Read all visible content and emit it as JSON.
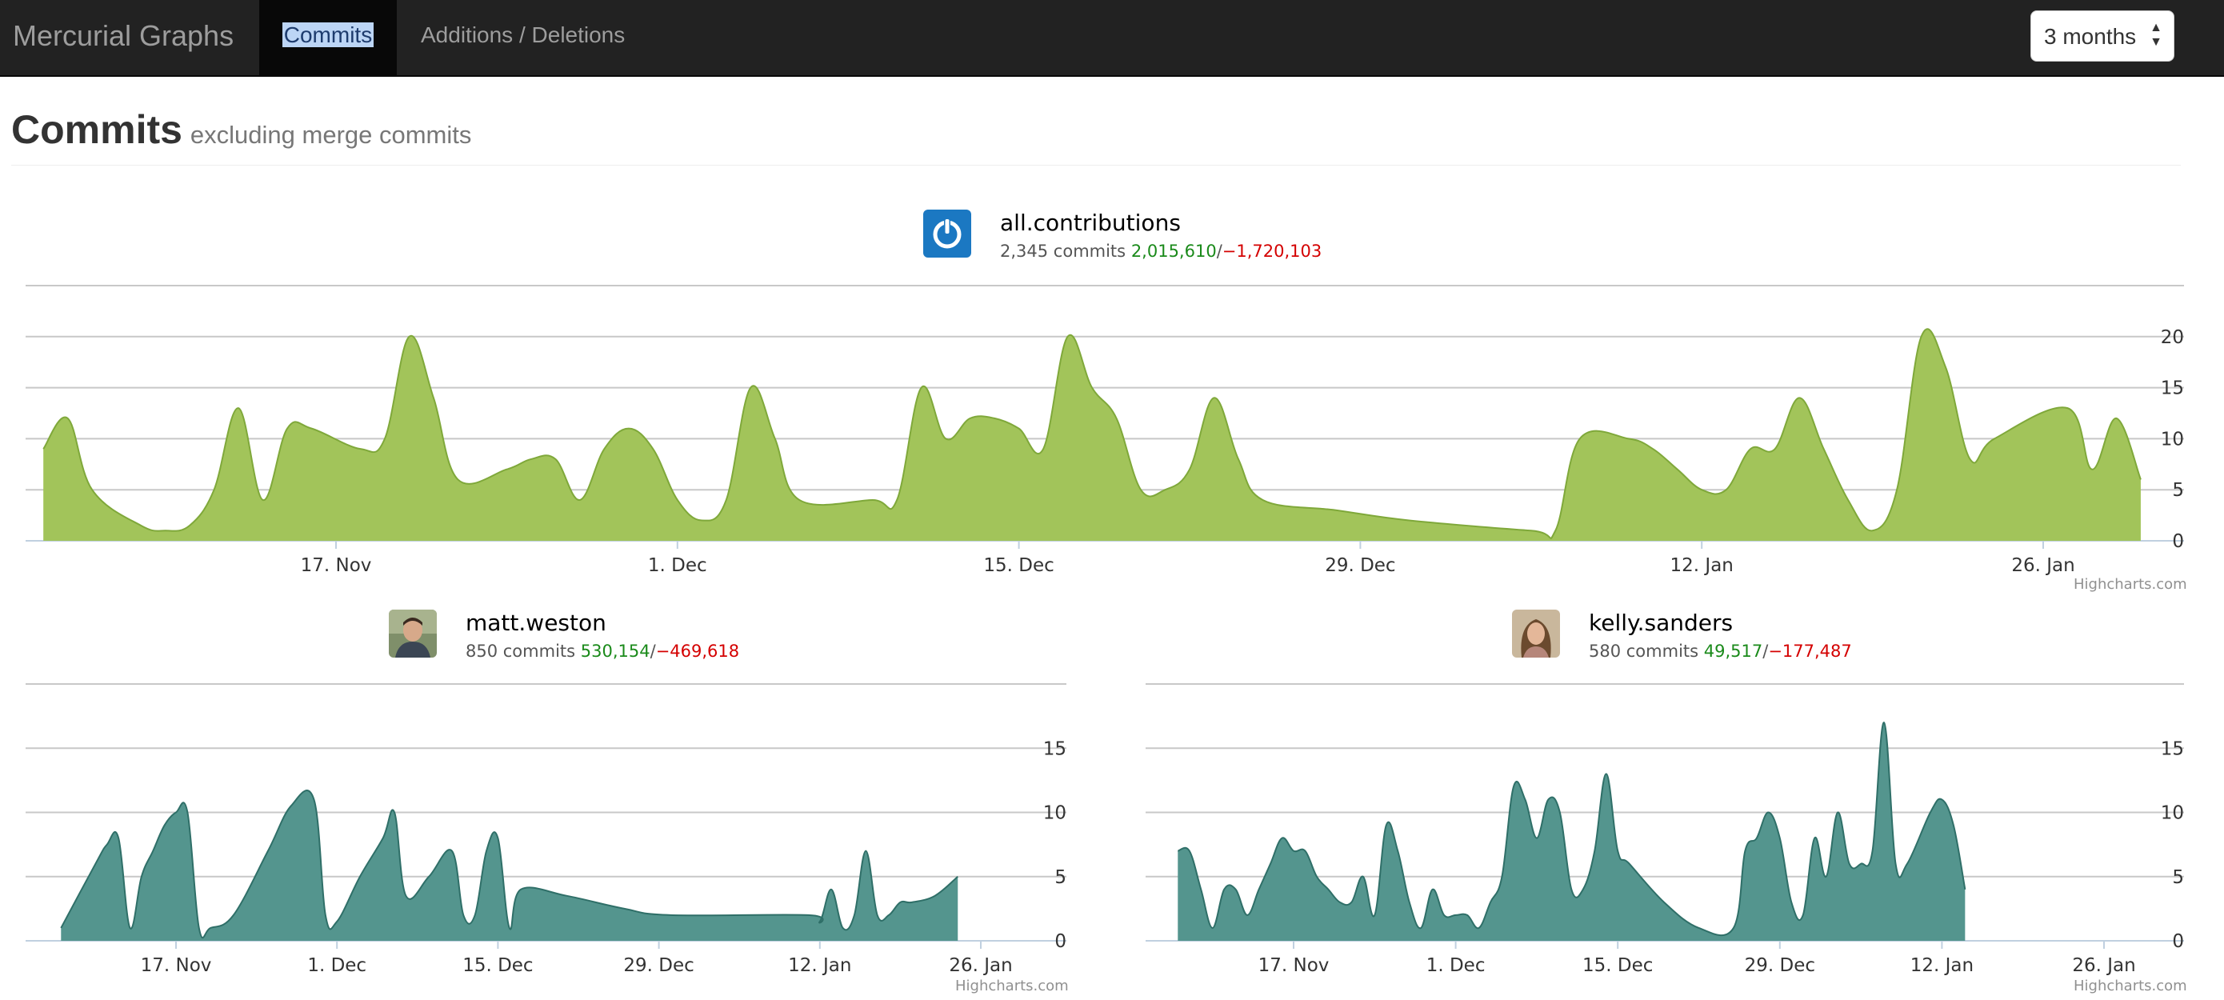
{
  "nav": {
    "brand": "Mercurial Graphs",
    "tabs": [
      {
        "label": "Commits",
        "active": true
      },
      {
        "label": "Additions / Deletions",
        "active": false
      }
    ],
    "range_select": {
      "value": "3 months"
    }
  },
  "header": {
    "title": "Commits",
    "subtitle": "excluding merge commits"
  },
  "colors": {
    "all_fill": "#a2c45a",
    "all_line": "#7fa83a",
    "user_fill": "#54958e",
    "user_line": "#2f6f68",
    "additions": "#1a8a1a",
    "deletions": "#d40000"
  },
  "credit": "Highcharts.com",
  "people": [
    {
      "name": "all.contributions",
      "commits_text": "2,345 commits",
      "additions": "2,015,610",
      "separator": "/",
      "deletions": "−1,720,103",
      "icon": "power-icon"
    },
    {
      "name": "matt.weston",
      "commits_text": "850 commits",
      "additions": "530,154",
      "separator": "/",
      "deletions": "−469,618",
      "icon": "avatar-photo"
    },
    {
      "name": "kelly.sanders",
      "commits_text": "580 commits",
      "additions": "49,517",
      "separator": "/",
      "deletions": "−177,487",
      "icon": "avatar-photo"
    }
  ],
  "chart_data": [
    {
      "type": "area",
      "title": "all.contributions",
      "x_ticks": [
        {
          "day": 19,
          "label": "17. Nov"
        },
        {
          "day": 33,
          "label": "1. Dec"
        },
        {
          "day": 47,
          "label": "15. Dec"
        },
        {
          "day": 61,
          "label": "29. Dec"
        },
        {
          "day": 75,
          "label": "12. Jan"
        },
        {
          "day": 89,
          "label": "26. Jan"
        }
      ],
      "y_ticks": [
        0,
        5,
        10,
        15,
        20
      ],
      "ylim": [
        0,
        25
      ],
      "xlim": [
        6,
        92
      ],
      "points": [
        [
          7,
          9
        ],
        [
          8,
          12
        ],
        [
          9,
          5
        ],
        [
          11,
          1.5
        ],
        [
          12,
          1
        ],
        [
          13,
          1.5
        ],
        [
          14,
          5
        ],
        [
          15,
          13
        ],
        [
          16,
          4
        ],
        [
          17,
          11
        ],
        [
          18,
          11
        ],
        [
          20,
          9
        ],
        [
          21,
          10
        ],
        [
          22,
          20
        ],
        [
          23,
          14
        ],
        [
          24,
          6
        ],
        [
          26,
          7
        ],
        [
          27,
          8
        ],
        [
          28,
          8
        ],
        [
          29,
          4
        ],
        [
          30,
          9
        ],
        [
          31,
          11
        ],
        [
          32,
          9
        ],
        [
          33,
          4
        ],
        [
          34,
          2
        ],
        [
          35,
          4
        ],
        [
          36,
          15
        ],
        [
          37,
          10
        ],
        [
          38,
          4
        ],
        [
          41,
          4
        ],
        [
          42,
          4
        ],
        [
          43,
          15
        ],
        [
          44,
          10
        ],
        [
          45,
          12
        ],
        [
          46,
          12
        ],
        [
          47,
          11
        ],
        [
          48,
          9
        ],
        [
          49,
          20
        ],
        [
          50,
          15
        ],
        [
          51,
          12
        ],
        [
          52,
          5
        ],
        [
          53,
          5
        ],
        [
          54,
          7
        ],
        [
          55,
          14
        ],
        [
          56,
          8
        ],
        [
          57,
          4
        ],
        [
          60,
          3
        ],
        [
          63,
          2
        ],
        [
          68,
          1
        ],
        [
          69,
          1
        ],
        [
          70,
          10
        ],
        [
          72,
          10
        ],
        [
          73,
          9
        ],
        [
          74,
          7
        ],
        [
          75,
          5
        ],
        [
          76,
          5
        ],
        [
          77,
          9
        ],
        [
          78,
          9
        ],
        [
          79,
          14
        ],
        [
          80,
          9
        ],
        [
          81,
          4
        ],
        [
          82,
          1
        ],
        [
          83,
          5
        ],
        [
          84,
          20
        ],
        [
          85,
          17
        ],
        [
          86,
          8
        ],
        [
          87,
          10
        ],
        [
          90,
          13
        ],
        [
          91,
          7
        ],
        [
          92,
          12
        ],
        [
          93,
          6
        ]
      ],
      "credit_shown": true
    },
    {
      "type": "area",
      "title": "matt.weston",
      "x_ticks": [
        {
          "day": 19,
          "label": "17. Nov"
        },
        {
          "day": 33,
          "label": "1. Dec"
        },
        {
          "day": 47,
          "label": "15. Dec"
        },
        {
          "day": 61,
          "label": "29. Dec"
        },
        {
          "day": 75,
          "label": "12. Jan"
        },
        {
          "day": 89,
          "label": "26. Jan"
        }
      ],
      "y_ticks": [
        0,
        5,
        10,
        15
      ],
      "ylim": [
        0,
        20
      ],
      "xlim": [
        8,
        92
      ],
      "points": [
        [
          9,
          1
        ],
        [
          12,
          6
        ],
        [
          13,
          7.5
        ],
        [
          14,
          8
        ],
        [
          15,
          1
        ],
        [
          16,
          5
        ],
        [
          17,
          7
        ],
        [
          18,
          9
        ],
        [
          19,
          10
        ],
        [
          20,
          10
        ],
        [
          21,
          1
        ],
        [
          22,
          1
        ],
        [
          24,
          2
        ],
        [
          27,
          7
        ],
        [
          29,
          10.5
        ],
        [
          31,
          11
        ],
        [
          32,
          2
        ],
        [
          33,
          1.5
        ],
        [
          35,
          5
        ],
        [
          37,
          8
        ],
        [
          38,
          10
        ],
        [
          39,
          3.5
        ],
        [
          41,
          5
        ],
        [
          43,
          7
        ],
        [
          44,
          2
        ],
        [
          45,
          2
        ],
        [
          46,
          7
        ],
        [
          47,
          8
        ],
        [
          48,
          1
        ],
        [
          49,
          4
        ],
        [
          53,
          3.5
        ],
        [
          58,
          2.5
        ],
        [
          62,
          2
        ],
        [
          74,
          2
        ],
        [
          75,
          1.5
        ],
        [
          76,
          4
        ],
        [
          77,
          1
        ],
        [
          78,
          2
        ],
        [
          79,
          7
        ],
        [
          80,
          2
        ],
        [
          81,
          2
        ],
        [
          82,
          3
        ],
        [
          83,
          3
        ],
        [
          85,
          3.5
        ],
        [
          87,
          5
        ]
      ],
      "credit_shown": true
    },
    {
      "type": "area",
      "title": "kelly.sanders",
      "x_ticks": [
        {
          "day": 19,
          "label": "17. Nov"
        },
        {
          "day": 33,
          "label": "1. Dec"
        },
        {
          "day": 47,
          "label": "15. Dec"
        },
        {
          "day": 61,
          "label": "29. Dec"
        },
        {
          "day": 75,
          "label": "12. Jan"
        },
        {
          "day": 89,
          "label": "26. Jan"
        }
      ],
      "y_ticks": [
        0,
        5,
        10,
        15
      ],
      "ylim": [
        0,
        20
      ],
      "xlim": [
        8,
        92
      ],
      "points": [
        [
          9,
          7
        ],
        [
          10,
          7
        ],
        [
          11,
          4
        ],
        [
          12,
          1
        ],
        [
          13,
          4
        ],
        [
          14,
          4
        ],
        [
          15,
          2
        ],
        [
          16,
          4
        ],
        [
          17,
          6
        ],
        [
          18,
          8
        ],
        [
          19,
          7
        ],
        [
          20,
          7
        ],
        [
          21,
          5
        ],
        [
          22,
          4
        ],
        [
          23,
          3
        ],
        [
          24,
          3
        ],
        [
          25,
          5
        ],
        [
          26,
          2
        ],
        [
          27,
          9
        ],
        [
          28,
          7
        ],
        [
          29,
          3
        ],
        [
          30,
          1
        ],
        [
          31,
          4
        ],
        [
          32,
          2
        ],
        [
          33,
          2
        ],
        [
          34,
          2
        ],
        [
          35,
          1
        ],
        [
          36,
          3
        ],
        [
          37,
          5
        ],
        [
          38,
          12
        ],
        [
          39,
          11
        ],
        [
          40,
          8
        ],
        [
          41,
          11
        ],
        [
          42,
          10
        ],
        [
          43,
          4
        ],
        [
          44,
          4
        ],
        [
          45,
          7
        ],
        [
          46,
          13
        ],
        [
          47,
          7
        ],
        [
          48,
          6
        ],
        [
          51,
          3
        ],
        [
          54,
          1
        ],
        [
          57,
          1
        ],
        [
          58,
          7
        ],
        [
          59,
          8
        ],
        [
          60,
          10
        ],
        [
          61,
          8
        ],
        [
          62,
          3
        ],
        [
          63,
          2
        ],
        [
          64,
          8
        ],
        [
          65,
          5
        ],
        [
          66,
          10
        ],
        [
          67,
          6
        ],
        [
          68,
          6
        ],
        [
          69,
          7
        ],
        [
          70,
          17
        ],
        [
          71,
          6
        ],
        [
          72,
          6
        ],
        [
          74,
          10
        ],
        [
          75,
          11
        ],
        [
          76,
          9
        ],
        [
          77,
          4
        ]
      ],
      "credit_shown": true
    }
  ]
}
